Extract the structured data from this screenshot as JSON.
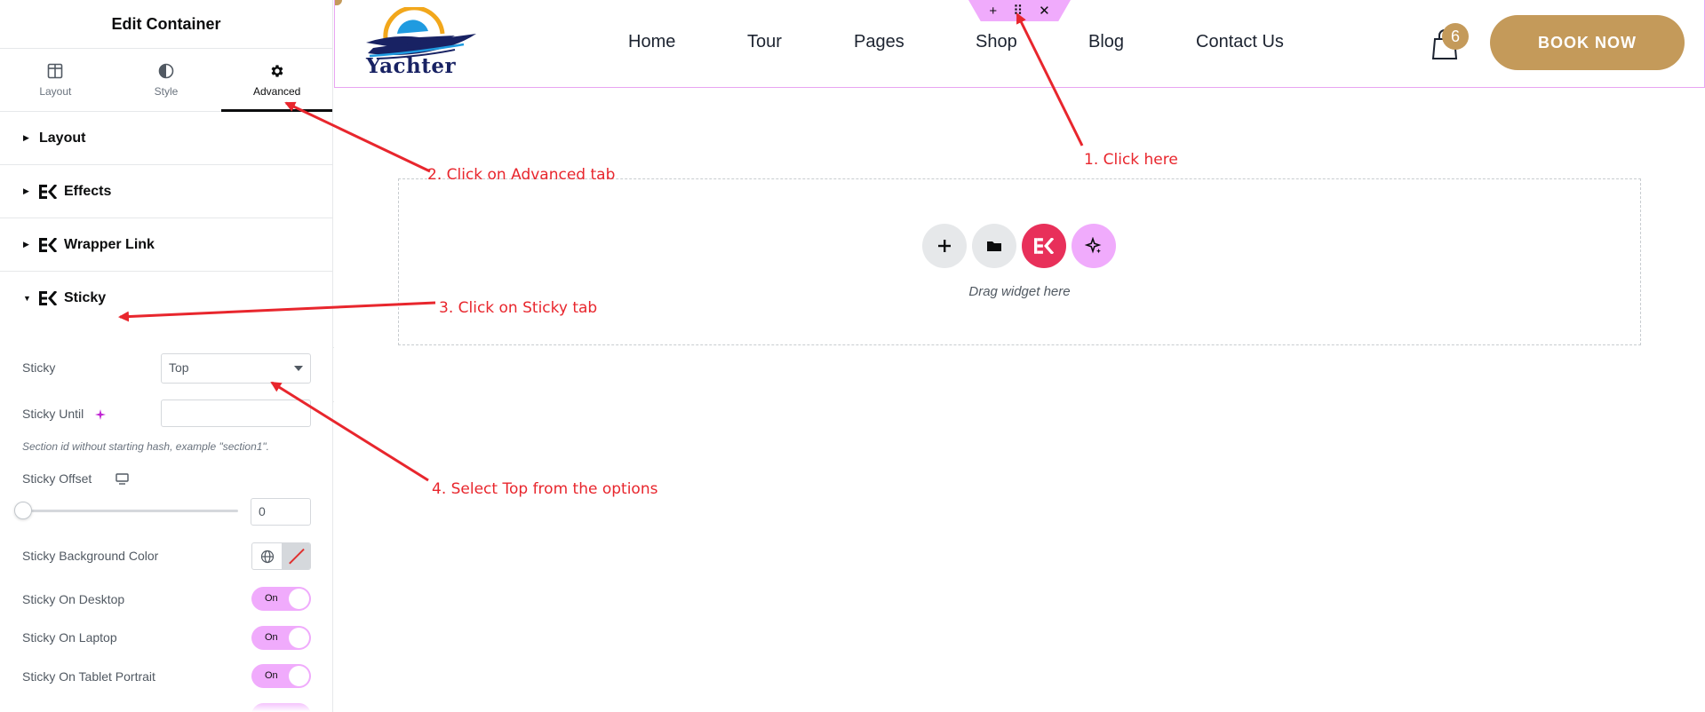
{
  "sidebar": {
    "title": "Edit Container",
    "tabs": [
      {
        "label": "Layout",
        "icon": "layout-columns-icon"
      },
      {
        "label": "Style",
        "icon": "half-circle-icon"
      },
      {
        "label": "Advanced",
        "icon": "gear-icon",
        "active": true
      }
    ],
    "sections": [
      {
        "label": "Layout",
        "expanded": false
      },
      {
        "label": "Effects",
        "expanded": false
      },
      {
        "label": "Wrapper Link",
        "expanded": false
      },
      {
        "label": "Sticky",
        "expanded": true
      }
    ],
    "sticky": {
      "sticky_label": "Sticky",
      "sticky_value": "Top",
      "until_label": "Sticky Until",
      "until_value": "",
      "until_hint": "Section id without starting hash, example \"section1\".",
      "offset_label": "Sticky Offset",
      "offset_value": "0",
      "bg_color_label": "Sticky Background Color",
      "toggles": [
        {
          "label": "Sticky On Desktop",
          "state": "On"
        },
        {
          "label": "Sticky On Laptop",
          "state": "On"
        },
        {
          "label": "Sticky On Tablet Portrait",
          "state": "On"
        }
      ]
    }
  },
  "site": {
    "logo_text": "Yachter",
    "nav": [
      "Home",
      "Tour",
      "Pages",
      "Shop",
      "Blog",
      "Contact Us"
    ],
    "cart_count": "6",
    "cta": "BOOK NOW",
    "toolbar": {
      "add": "+",
      "move": "⠿",
      "close": "✕"
    },
    "dropzone_text": "Drag widget here"
  },
  "annotations": [
    "1. Click here",
    "2.  Click on Advanced tab",
    "3. Click on Sticky tab",
    "4. Select Top from the options"
  ],
  "colors": {
    "accent_pink": "#f0abfc",
    "brand_gold": "#c49a5a",
    "elementor_red": "#e8305a",
    "annotation_red": "#e8262d",
    "navy": "#182263"
  }
}
